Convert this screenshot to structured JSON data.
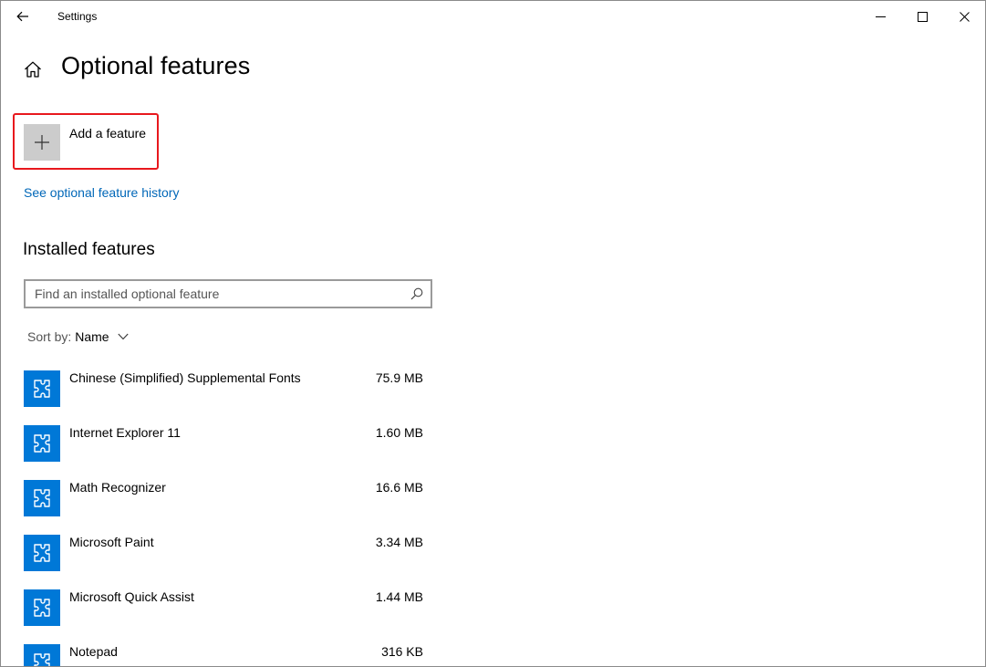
{
  "window": {
    "title": "Settings"
  },
  "header": {
    "title": "Optional features"
  },
  "add_feature": {
    "label": "Add a feature"
  },
  "links": {
    "history": "See optional feature history"
  },
  "installed": {
    "title": "Installed features",
    "search_placeholder": "Find an installed optional feature",
    "search_value": "",
    "sort_label": "Sort by:",
    "sort_value": "Name",
    "items": [
      {
        "name": "Chinese (Simplified) Supplemental Fonts",
        "size": "75.9 MB",
        "icon": "puzzle-icon"
      },
      {
        "name": "Internet Explorer 11",
        "size": "1.60 MB",
        "icon": "puzzle-icon"
      },
      {
        "name": "Math Recognizer",
        "size": "16.6 MB",
        "icon": "puzzle-icon"
      },
      {
        "name": "Microsoft Paint",
        "size": "3.34 MB",
        "icon": "puzzle-icon"
      },
      {
        "name": "Microsoft Quick Assist",
        "size": "1.44 MB",
        "icon": "puzzle-icon"
      },
      {
        "name": "Notepad",
        "size": "316 KB",
        "icon": "puzzle-icon"
      }
    ]
  },
  "colors": {
    "accent": "#0078d7",
    "link": "#0067b8",
    "highlight_border": "#e8181d",
    "add_tile": "#cccccc"
  },
  "icons": [
    "back-arrow-icon",
    "minimize-icon",
    "maximize-icon",
    "close-icon",
    "home-icon",
    "plus-icon",
    "search-icon",
    "chevron-down-icon",
    "puzzle-icon"
  ]
}
